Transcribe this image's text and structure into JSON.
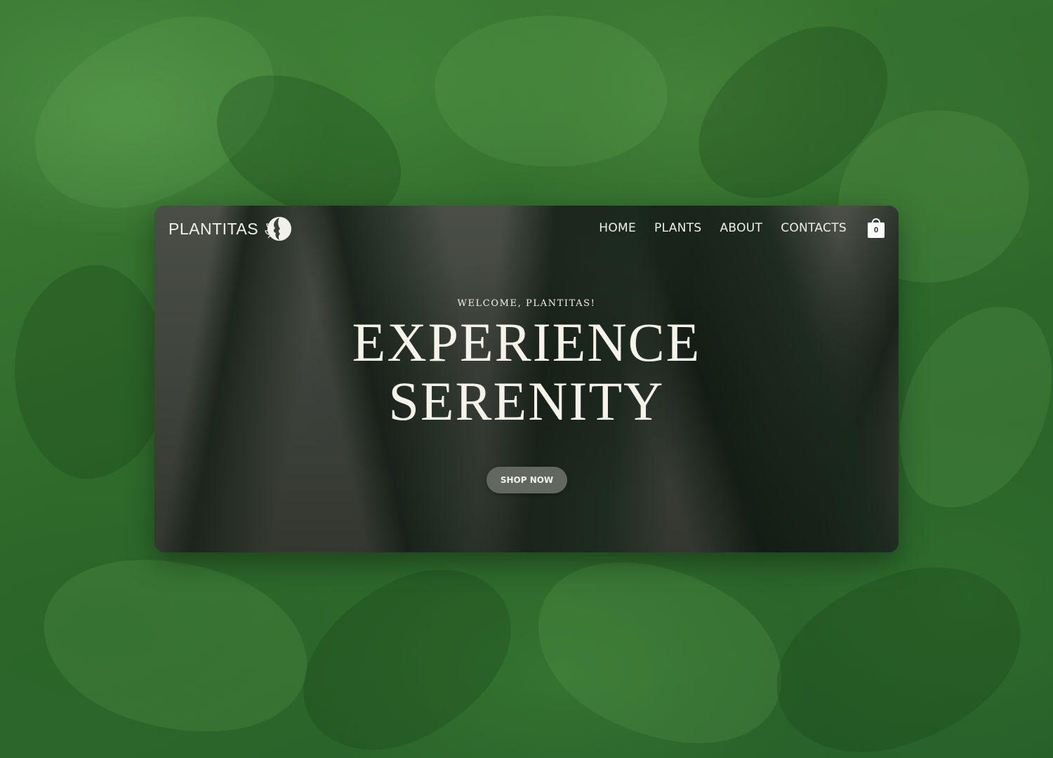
{
  "brand": {
    "name": "PLANTITAS",
    "logo_icon": "face-leaf-logo-icon"
  },
  "nav": {
    "items": [
      {
        "label": "HOME"
      },
      {
        "label": "PLANTS"
      },
      {
        "label": "ABOUT"
      },
      {
        "label": "CONTACTS"
      }
    ],
    "cart": {
      "icon": "shopping-bag-icon",
      "count": "0"
    }
  },
  "hero": {
    "eyebrow": "WELCOME, PLANTITAS!",
    "headline_line1": "EXPERIENCE",
    "headline_line2": "SERENITY",
    "cta_label": "SHOP NOW"
  },
  "colors": {
    "page_background": "#2f6a2a",
    "hero_overlay": "#3b3f39",
    "button": "#62675f",
    "text": "#f6f3ea"
  }
}
